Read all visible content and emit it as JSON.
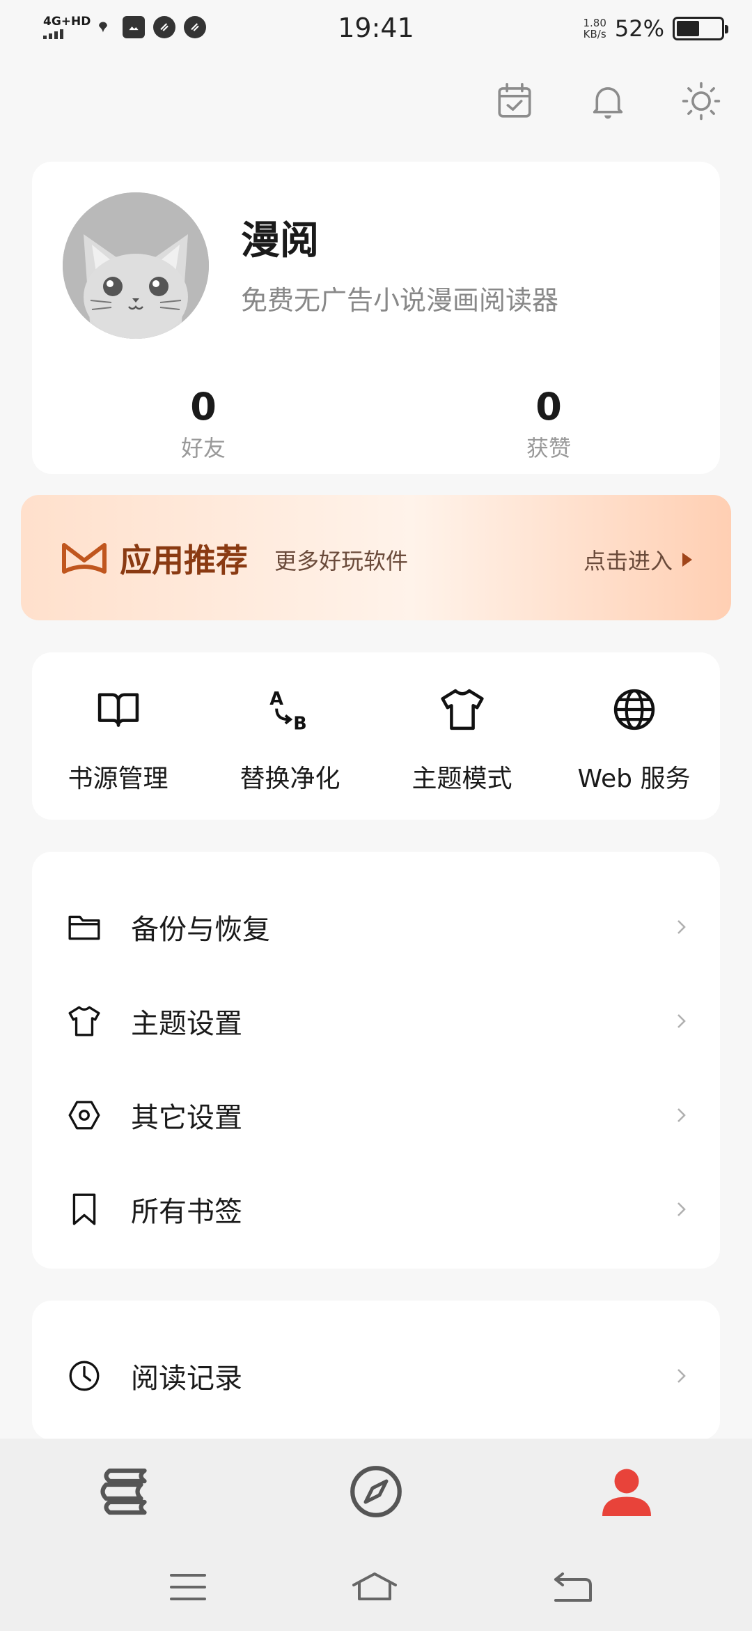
{
  "status_bar": {
    "network": "4G+HD",
    "time": "19:41",
    "speed_value": "1.80",
    "speed_unit": "KB/s",
    "battery_percent": "52%",
    "battery_level": 0.52
  },
  "header": {
    "icons": [
      "calendar-check-icon",
      "bell-icon",
      "sun-icon"
    ]
  },
  "profile": {
    "name": "漫阅",
    "description": "免费无广告小说漫画阅读器",
    "friends_count": "0",
    "friends_label": "好友",
    "likes_count": "0",
    "likes_label": "获赞"
  },
  "promo": {
    "title": "应用推荐",
    "subtitle": "更多好玩软件",
    "action": "点击进入"
  },
  "quick_actions": [
    {
      "label": "书源管理",
      "icon": "book-open-icon"
    },
    {
      "label": "替换净化",
      "icon": "replace-ab-icon"
    },
    {
      "label": "主题模式",
      "icon": "tshirt-icon"
    },
    {
      "label": "Web 服务",
      "icon": "globe-icon"
    }
  ],
  "menu": [
    {
      "label": "备份与恢复",
      "icon": "folder-icon"
    },
    {
      "label": "主题设置",
      "icon": "tshirt-icon"
    },
    {
      "label": "其它设置",
      "icon": "hexagon-settings-icon"
    },
    {
      "label": "所有书签",
      "icon": "bookmark-icon"
    }
  ],
  "menu2": [
    {
      "label": "阅读记录",
      "icon": "clock-icon"
    }
  ],
  "tabs": [
    {
      "name": "bookshelf",
      "icon": "books-icon",
      "active": false
    },
    {
      "name": "discover",
      "icon": "compass-icon",
      "active": false
    },
    {
      "name": "profile",
      "icon": "person-icon",
      "active": true
    }
  ],
  "colors": {
    "accent": "#e8433a",
    "promo_title": "#8a3a12",
    "background": "#f7f7f7"
  }
}
